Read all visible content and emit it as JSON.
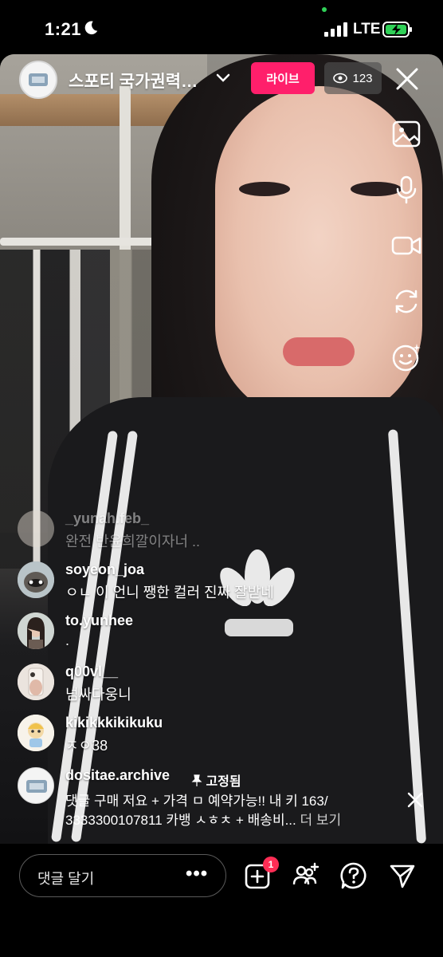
{
  "status": {
    "time": "1:21",
    "network": "LTE"
  },
  "live": {
    "host_name": "스포티 국가권력…",
    "live_label": "라이브",
    "viewer_count": "123"
  },
  "comments": [
    {
      "user": "_yunah.feb_",
      "text": "완전 반윤희깔이자너 .."
    },
    {
      "user": "soyeon_joa",
      "text": "ㅇㄴ 이 언니 쨍한 컬러 진짜 잘받네"
    },
    {
      "user": "to.yunhee",
      "text": "."
    },
    {
      "user": "q00vl__",
      "text": "넘싸다웅니"
    },
    {
      "user": "kikikkkikikuku",
      "text": "ㅈㅇ38"
    }
  ],
  "pinned": {
    "user": "dositae.archive",
    "pin_label": "고정됨",
    "line1": "댓글 구매 저요 + 가격 ㅁ 예약가능!! 내 키 163/",
    "line2": "3333300107811 카뱅 ㅅㅎㅊ + 배송비...",
    "more": "더 보기"
  },
  "bottom": {
    "comment_placeholder": "댓글 달기",
    "more_dots": "•••",
    "invite_badge": "1"
  },
  "icons": {
    "top": [
      "host-avatar",
      "chevron-down-icon",
      "eye-icon",
      "close-icon"
    ],
    "side": [
      "image-icon",
      "microphone-icon",
      "video-camera-icon",
      "flip-camera-icon",
      "face-effects-icon"
    ],
    "bottom": [
      "add-guest-icon",
      "add-people-icon",
      "question-icon",
      "send-icon"
    ]
  },
  "colors": {
    "live_badge": "#ff1f6b",
    "notification_badge": "#ff2d55"
  }
}
